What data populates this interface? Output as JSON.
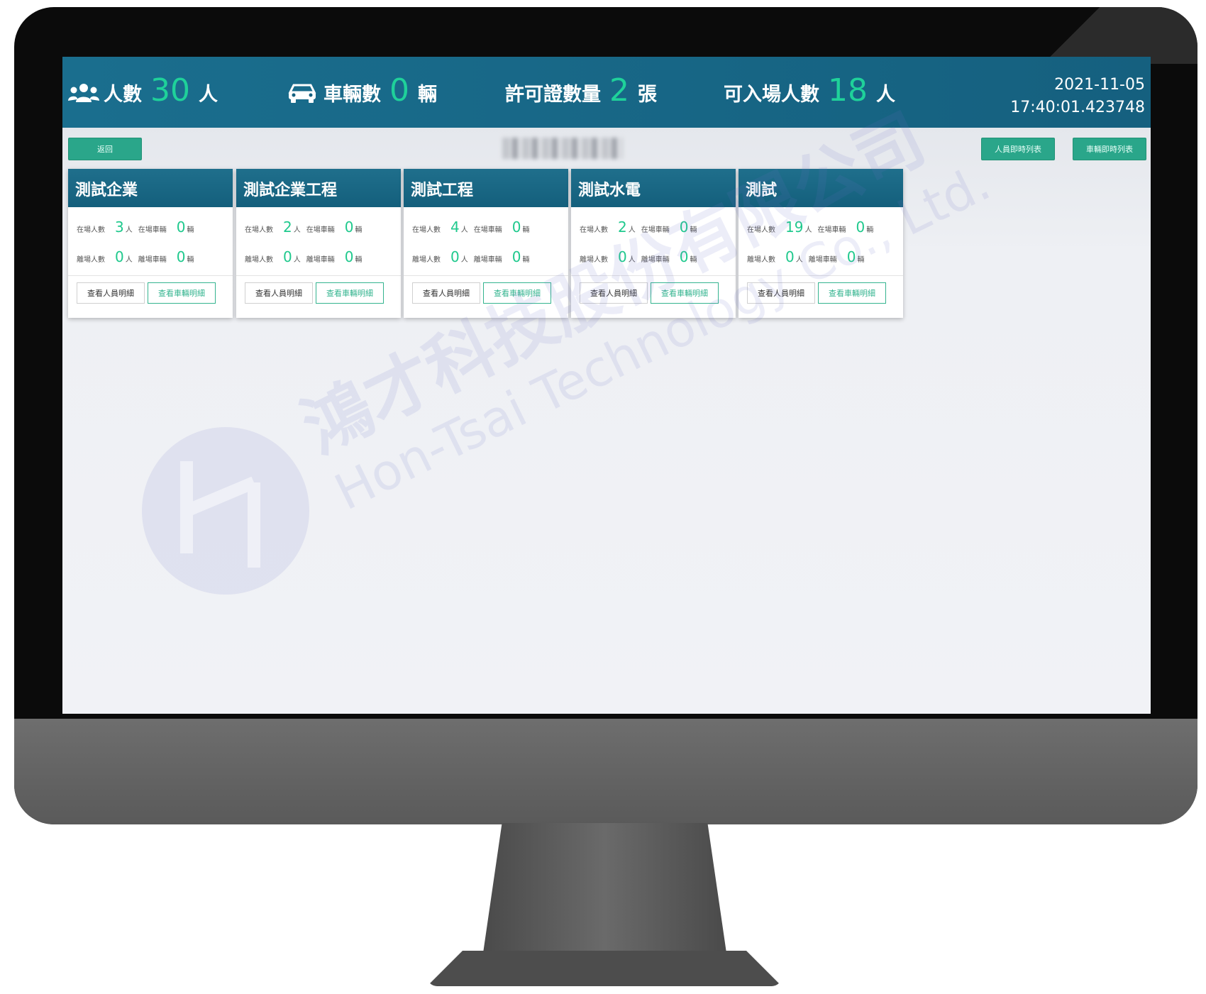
{
  "header": {
    "people": {
      "label": "人數",
      "value": "30",
      "unit": "人"
    },
    "vehicles": {
      "label": "車輛數",
      "value": "0",
      "unit": "輛"
    },
    "permits": {
      "label": "許可證數量",
      "value": "2",
      "unit": "張"
    },
    "allowed": {
      "label": "可入場人數",
      "value": "18",
      "unit": "人"
    },
    "date": "2021-11-05",
    "time": "17:40:01.423748"
  },
  "toolbar": {
    "back_label": "返回",
    "people_list_label": "人員即時列表",
    "vehicle_list_label": "車輛即時列表"
  },
  "labels": {
    "onsite_people": "在場人數",
    "onsite_vehicles": "在場車輛",
    "left_people": "離場人數",
    "left_vehicles": "離場車輛",
    "people_unit": "人",
    "vehicle_unit": "輛",
    "view_people": "查看人員明細",
    "view_vehicles": "查看車輛明細"
  },
  "cards": [
    {
      "title": "測試企業",
      "onsite_people": "3",
      "onsite_vehicles": "0",
      "left_people": "0",
      "left_vehicles": "0"
    },
    {
      "title": "測試企業工程",
      "onsite_people": "2",
      "onsite_vehicles": "0",
      "left_people": "0",
      "left_vehicles": "0"
    },
    {
      "title": "測試工程",
      "onsite_people": "4",
      "onsite_vehicles": "0",
      "left_people": "0",
      "left_vehicles": "0"
    },
    {
      "title": "測試水電",
      "onsite_people": "2",
      "onsite_vehicles": "0",
      "left_people": "0",
      "left_vehicles": "0"
    },
    {
      "title": "測試",
      "onsite_people": "19",
      "onsite_vehicles": "0",
      "left_people": "0",
      "left_vehicles": "0"
    }
  ],
  "watermark": {
    "cn": "鴻才科技股份有限公司",
    "en": "Hon-Tsai Technology Co., Ltd."
  },
  "colors": {
    "header_bg": "#1a6e8e",
    "accent_green": "#1fd19a",
    "button_green": "#2aa68a"
  }
}
